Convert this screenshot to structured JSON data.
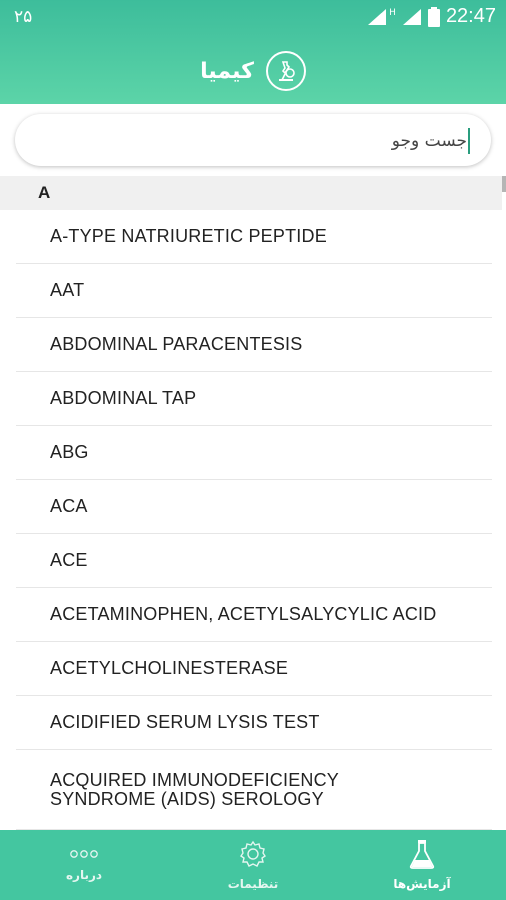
{
  "status_bar": {
    "left_text": "۲۵",
    "time": "22:47",
    "signal_badge": "H"
  },
  "app_bar": {
    "title": "کیمیا"
  },
  "search": {
    "placeholder": "جست وجو"
  },
  "section": {
    "letter": "A"
  },
  "list_items": [
    "A-TYPE NATRIURETIC PEPTIDE",
    "AAT",
    "ABDOMINAL PARACENTESIS",
    "ABDOMINAL TAP",
    "ABG",
    "ACA",
    "ACE",
    "ACETAMINOPHEN, ACETYLSALYCYLIC ACID",
    "ACETYLCHOLINESTERASE",
    "ACIDIFIED SERUM LYSIS TEST",
    "ACQUIRED IMMUNODEFICIENCY SYNDROME (AIDS) SEROLOGY"
  ],
  "bottom_nav": {
    "about": "درباره",
    "settings": "تنظیمات",
    "tests": "آزمایش‌ها"
  },
  "colors": {
    "primary": "#44c6a0",
    "header_top": "#3dbd9b",
    "header_bottom": "#5cd4a8"
  }
}
